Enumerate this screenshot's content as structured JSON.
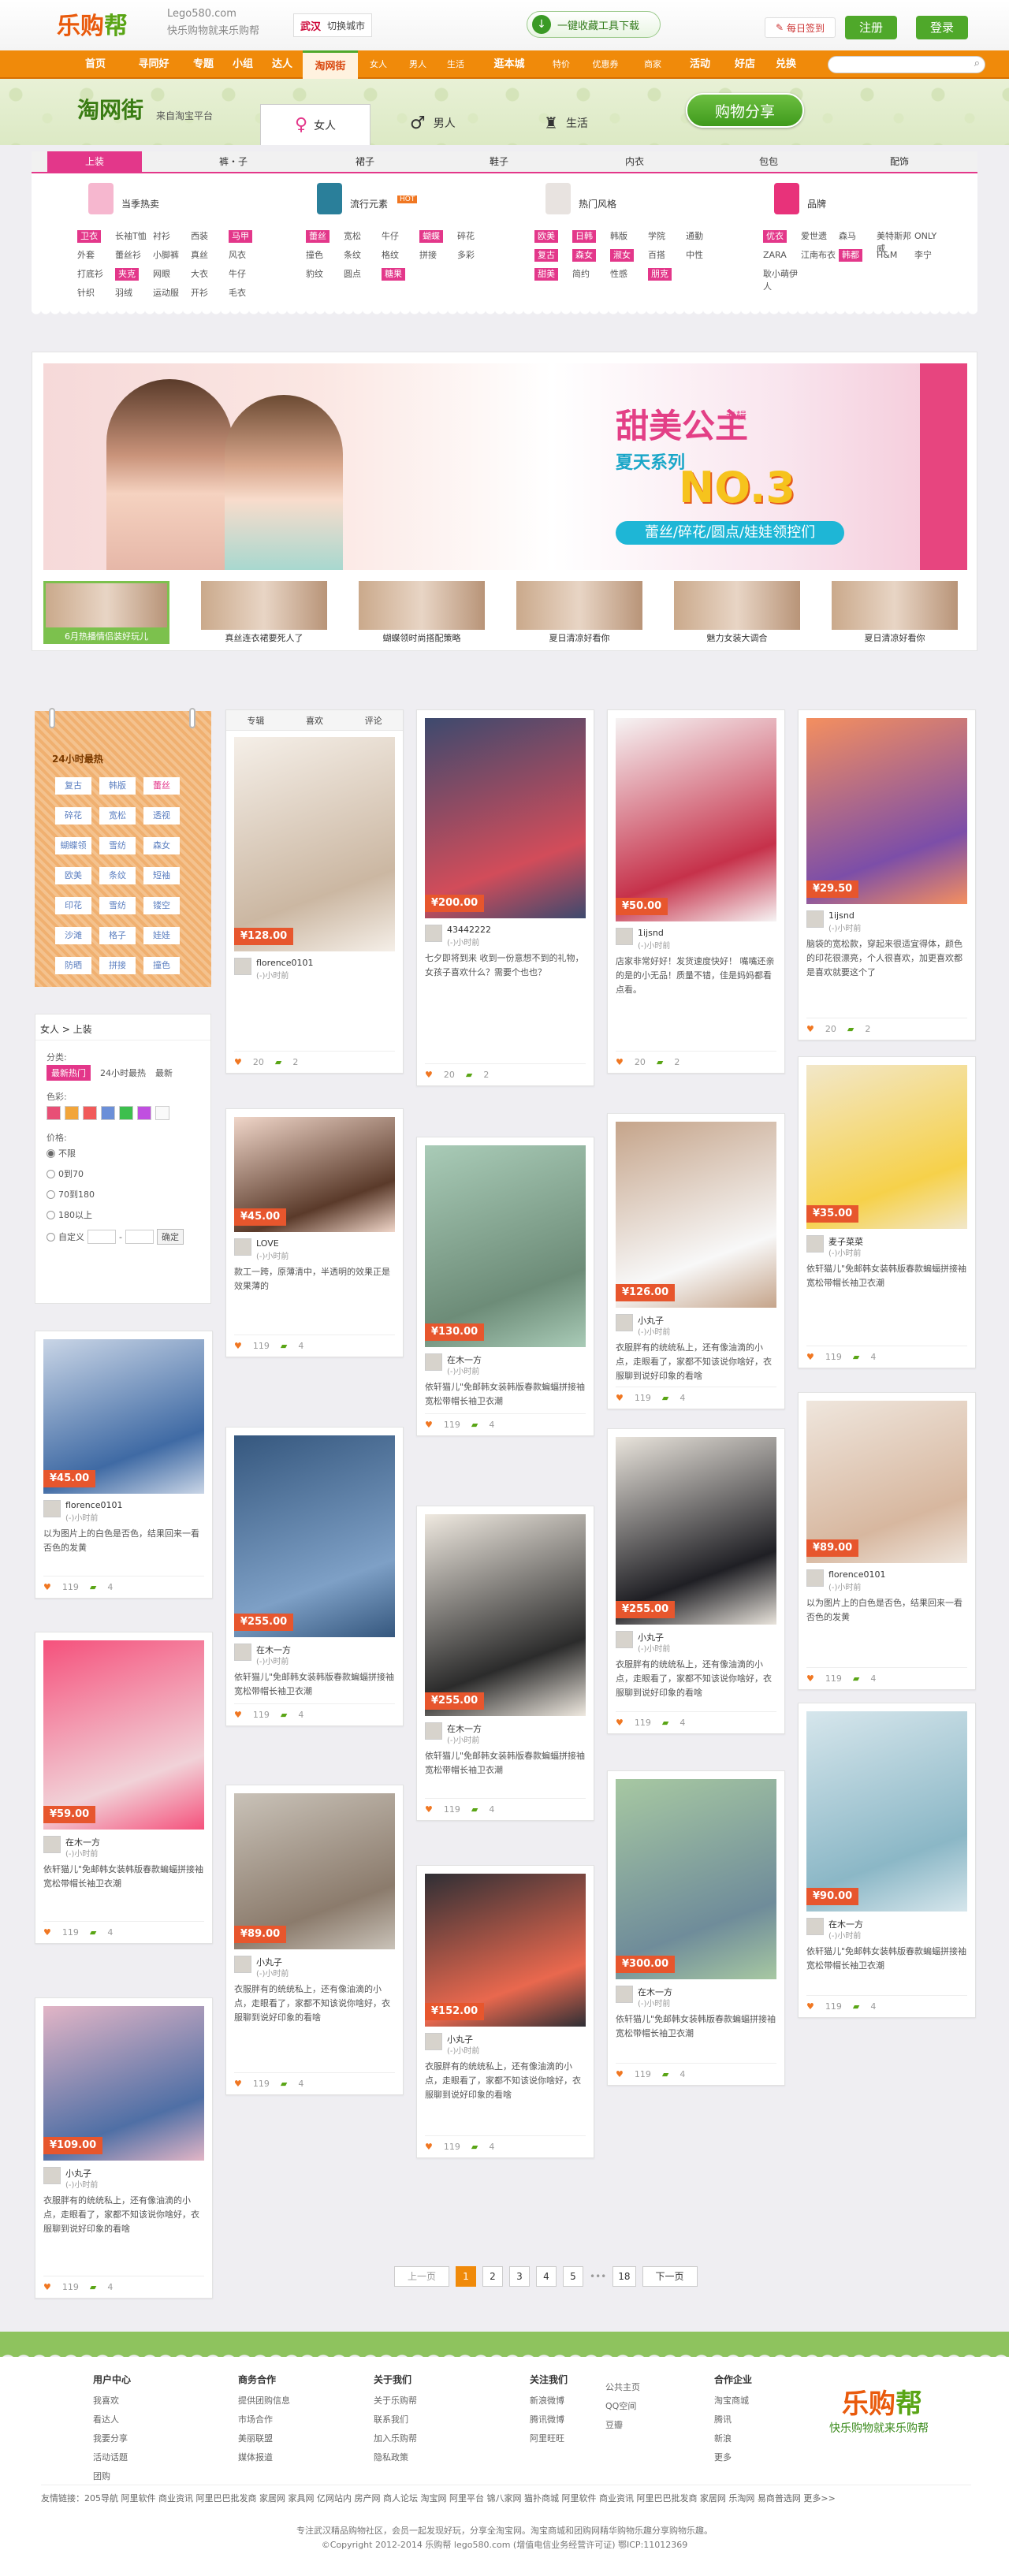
{
  "topbar": {
    "logo_main": "乐购",
    "logo_accent": "帮",
    "domain": "Lego580.com",
    "slogan": "快乐购物就来乐购帮",
    "city": "武汉",
    "switch_city": "切换城市",
    "collect_tool": "一键收藏工具下载",
    "daily_sign": "每日签到",
    "register": "注册",
    "login": "登录"
  },
  "nav": {
    "items": [
      "首页",
      "寻同好",
      "专题",
      "小组",
      "达人",
      "淘网街",
      "女人",
      "男人",
      "生活",
      "逛本城",
      "特价",
      "优惠券",
      "商家",
      "活动",
      "好店",
      "兑换"
    ],
    "active": "淘网街"
  },
  "header": {
    "title": "淘网街",
    "subtitle": "来自淘宝平台",
    "tab_women": "女人",
    "tab_men": "男人",
    "tab_life": "生活",
    "share": "购物分享"
  },
  "categories": {
    "tabs": [
      "上装",
      "裤・子",
      "裙子",
      "鞋子",
      "内衣",
      "包包",
      "配饰"
    ],
    "columns": [
      {
        "title": "当季热卖",
        "color": "#f6b7cf",
        "tags": [
          "卫衣",
          "长袖T恤",
          "衬衫",
          "西装",
          "马甲",
          "外套",
          "蕾丝衫",
          "小脚裤",
          "真丝",
          "风衣",
          "打底衫",
          "夹克",
          "网眼",
          "大衣",
          "牛仔",
          "针织",
          "羽绒",
          "运动服",
          "开衫",
          "毛衣"
        ],
        "hl": [
          "卫衣",
          "马甲",
          "夹克"
        ]
      },
      {
        "title": "流行元素",
        "badge": "HOT",
        "color": "#2a7f9a",
        "tags": [
          "蕾丝",
          "宽松",
          "牛仔",
          "蝴蝶结",
          "碎花",
          "撞色",
          "条纹",
          "格纹",
          "拼接",
          "多彩",
          "豹纹",
          "圆点",
          "糖果色"
        ],
        "hl": [
          "蕾丝",
          "蝴蝶结",
          "糖果色"
        ]
      },
      {
        "title": "热门风格",
        "color": "#e8e3e0",
        "tags": [
          "欧美",
          "日韩",
          "韩版",
          "学院",
          "通勤",
          "复古",
          "森女",
          "淑女",
          "百搭",
          "中性",
          "甜美",
          "简约",
          "性感",
          "朋克"
        ],
        "hl": [
          "欧美",
          "日韩",
          "淑女",
          "复古",
          "森女",
          "甜美",
          "朋克"
        ]
      },
      {
        "title": "品牌",
        "color": "#e8327a",
        "tags": [
          "优衣库",
          "爱世遗",
          "森马",
          "美特斯邦威",
          "ONLY",
          "ZARA",
          "江南布衣",
          "韩都衣舍",
          "H&M",
          "李宁",
          "耿小萌伊人"
        ],
        "hl": [
          "优衣库",
          "韩都衣舍"
        ]
      }
    ]
  },
  "banner": {
    "t1": "甜美公主",
    "t2": "专辑",
    "t3": "夏天系列",
    "t4": "NO.3",
    "t5": "蕾丝/碎花/圆点/娃娃领控们",
    "thumbs": [
      "6月热播情侣装好玩儿",
      "真丝连衣裙要死人了",
      "蝴蝶领时尚搭配策略",
      "夏日清凉好看你",
      "魅力女装大调合",
      "夏日清凉好看你"
    ]
  },
  "sidebar": {
    "hot_title": "24小时最热",
    "hot_tags": [
      "复古",
      "韩版",
      "蕾丝",
      "碎花",
      "宽松",
      "透视",
      "蝴蝶领",
      "雪纺",
      "森女",
      "欧美",
      "条纹",
      "短袖",
      "印花",
      "雪纺",
      "镂空",
      "沙滩",
      "格子",
      "娃娃",
      "防晒",
      "拼接",
      "撞色"
    ],
    "breadcrumb": "女人 > 上装",
    "sort_label": "分类:",
    "sort_options": [
      "最新热门",
      "24小时最热",
      "最新"
    ],
    "color_label": "色彩:",
    "colors": [
      "#e84f76",
      "#f2a53a",
      "#f15a5a",
      "#6b8fd8",
      "#3dbf4e",
      "#c04fe0",
      "#fafafa"
    ],
    "price_label": "价格:",
    "prices": [
      "不限",
      "0到70",
      "70到180",
      "180以上",
      "自定义"
    ],
    "confirm": "确定"
  },
  "cards": [
    {
      "col": 0,
      "price": "¥128.00",
      "user": "florence0101",
      "meta": "(-)小时前",
      "desc": "",
      "likes": "20",
      "comments": "2",
      "pic": "#f5efe8",
      "pic2": "#cbb7a2"
    },
    {
      "col": 0,
      "price": "¥45.00",
      "user": "LOVE",
      "meta": "(-)小时前",
      "desc": "款工一跨，原薄清中，半透明的效果正是效果薄的",
      "likes": "119",
      "comments": "4",
      "pic": "#f0d6c9",
      "pic2": "#5a3a2a"
    },
    {
      "col": 1,
      "price": "¥200.00",
      "user": "43442222",
      "meta": "(-)小时前",
      "desc": "七夕即将到来 收到一份意想不到的礼物，女孩子喜欢什么？需要个也也？",
      "likes": "20",
      "comments": "2",
      "pic": "#3d4a6e",
      "pic2": "#d24c5a"
    },
    {
      "col": 1,
      "price": "¥130.00",
      "user": "在木一方",
      "meta": "(-)小时前",
      "desc": "依轩猫儿\"免邮韩女装韩版春款蝙蝠拼接袖宽松带帽长袖卫衣潮",
      "likes": "119",
      "comments": "4",
      "pic": "#a9cbb7",
      "pic2": "#6d8c78"
    },
    {
      "col": 1,
      "price": "¥255.00",
      "user": "在木一方",
      "meta": "(-)小时前",
      "desc": "依轩猫儿\"免邮韩女装韩版春款蝙蝠拼接袖宽松带帽长袖卫衣潮",
      "likes": "119",
      "comments": "4",
      "pic": "#35577e",
      "pic2": "#7ea0c6"
    },
    {
      "col": 1,
      "price": "¥89.00",
      "user": "小丸子",
      "meta": "(-)小时前",
      "desc": "衣服胖有的统统私上，还有像油滴的小点，走眼看了，家都不知该说你啥好，衣服聊到说好印象的看啥",
      "likes": "119",
      "comments": "4",
      "pic": "#c9c2b8",
      "pic2": "#8b7b6c"
    },
    {
      "col": 2,
      "price": "¥50.00",
      "user": "1ijsnd",
      "meta": "(-)小时前",
      "desc": "店家非常好好！发货速度快好！ 嘴嘴还亲的是的小无品！质量不错，佳是妈妈都看点看。",
      "likes": "20",
      "comments": "2",
      "pic": "#f6f4f4",
      "pic2": "#c6314a"
    },
    {
      "col": 2,
      "price": "¥255.00",
      "user": "在木一方",
      "meta": "(-)小时前",
      "desc": "依轩猫儿\"免邮韩女装韩版春款蝙蝠拼接袖宽松带帽长袖卫衣潮",
      "likes": "119",
      "comments": "4",
      "pic": "#efe9e0",
      "pic2": "#2b2b2b"
    },
    {
      "col": 2,
      "price": "¥152.00",
      "user": "小丸子",
      "meta": "(-)小时前",
      "desc": "衣服胖有的统统私上，还有像油滴的小点，走眼看了，家都不知该说你啥好，衣服聊到说好印象的看啥",
      "likes": "119",
      "comments": "4",
      "pic": "#2f2f35",
      "pic2": "#e9684e"
    },
    {
      "col": 3,
      "price": "¥126.00",
      "user": "小丸子",
      "meta": "(-)小时前",
      "desc": "衣服胖有的统统私上，还有像油滴的小点，走眼看了，家都不知该说你啥好，衣服聊到说好印象的看啥",
      "likes": "119",
      "comments": "4",
      "pic": "#c5a48a",
      "pic2": "#f8f8f8"
    },
    {
      "col": 3,
      "price": "¥255.00",
      "user": "小丸子",
      "meta": "(-)小时前",
      "desc": "衣服胖有的统统私上，还有像油滴的小点，走眼看了，家都不知该说你啥好，衣服聊到说好印象的看啥",
      "likes": "119",
      "comments": "4",
      "pic": "#e9e4dc",
      "pic2": "#1f1f24"
    },
    {
      "col": 3,
      "price": "¥300.00",
      "user": "在木一方",
      "meta": "(-)小时前",
      "desc": "依轩猫儿\"免邮韩女装韩版春款蝙蝠拼接袖宽松带帽长袖卫衣潮",
      "likes": "119",
      "comments": "4",
      "pic": "#a7c8a2",
      "pic2": "#6f8c9a"
    },
    {
      "col": 4,
      "price": "¥29.50",
      "user": "1ijsnd",
      "meta": "(-)小时前",
      "desc": "脑袋的宽松款，穿起来很适宜得体，颜色的印花很漂亮，个人很喜欢，加更喜欢都是喜欢就要这个了",
      "likes": "20",
      "comments": "2",
      "pic": "#f48f5f",
      "pic2": "#7c4ea8"
    },
    {
      "col": 4,
      "price": "¥35.00",
      "user": "麦子菜菜",
      "meta": "(-)小时前",
      "desc": "依轩猫儿\"免邮韩女装韩版春款蝙蝠拼接袖宽松带帽长袖卫衣潮",
      "likes": "119",
      "comments": "4",
      "pic": "#f2e7c9",
      "pic2": "#f6d14a"
    },
    {
      "col": 4,
      "price": "¥89.00",
      "user": "florence0101",
      "meta": "(-)小时前",
      "desc": "以为图片上的白色是否色，结果回来一看否色的发黄",
      "likes": "119",
      "comments": "4",
      "pic": "#efe6dd",
      "pic2": "#d7b79f"
    },
    {
      "col": 4,
      "price": "¥90.00",
      "user": "在木一方",
      "meta": "(-)小时前",
      "desc": "依轩猫儿\"免邮韩女装韩版春款蝙蝠拼接袖宽松带帽长袖卫衣潮",
      "likes": "119",
      "comments": "4",
      "pic": "#d6e6ec",
      "pic2": "#8bb7c6"
    },
    {
      "col": 5,
      "price": "¥45.00",
      "user": "florence0101",
      "meta": "(-)小时前",
      "desc": "以为图片上的白色是否色，结果回来一看否色的发黄",
      "likes": "119",
      "comments": "4",
      "pic": "#c9d5e6",
      "pic2": "#3f6aa4"
    },
    {
      "col": 5,
      "price": "¥59.00",
      "user": "在木一方",
      "meta": "(-)小时前",
      "desc": "依轩猫儿\"免邮韩女装韩版春款蝙蝠拼接袖宽松带帽长袖卫衣潮",
      "likes": "119",
      "comments": "4",
      "pic": "#f5517c",
      "pic2": "#f1d2d8"
    },
    {
      "col": 5,
      "price": "¥109.00",
      "user": "小丸子",
      "meta": "(-)小时前",
      "desc": "衣服胖有的统统私上，还有像油滴的小点，走眼看了，家都不知该说你啥好，衣服聊到说好印象的看啥",
      "likes": "119",
      "comments": "4",
      "pic": "#e2b5c6",
      "pic2": "#4f6fa5"
    }
  ],
  "card_actions": [
    "专辑",
    "喜欢",
    "评论"
  ],
  "pager": {
    "prev": "上一页",
    "pages": [
      "1",
      "2",
      "3",
      "4",
      "5"
    ],
    "ellipsis": "•••",
    "last": "18",
    "next": "下一页"
  },
  "footer": {
    "cols": [
      {
        "head": "用户中心",
        "links": [
          "我喜欢",
          "看达人",
          "我要分享",
          "活动话题",
          "团购"
        ]
      },
      {
        "head": "商务合作",
        "links": [
          "提供团购信息",
          "市场合作",
          "美丽联盟",
          "媒体报道"
        ]
      },
      {
        "head": "关于我们",
        "links": [
          "关于乐购帮",
          "联系我们",
          "加入乐购帮",
          "隐私政策"
        ]
      },
      {
        "head": "关注我们",
        "links": [
          "新浪微博",
          "腾讯微博",
          "阿里旺旺"
        ]
      },
      {
        "head": "",
        "links": [
          "公共主页",
          "QQ空间",
          "豆瓣"
        ]
      },
      {
        "head": "合作企业",
        "links": [
          "淘宝商城",
          "腾讯",
          "新浪",
          "更多"
        ]
      }
    ],
    "logo_main": "乐购",
    "logo_accent": "帮",
    "slogan": "快乐购物就来乐购帮",
    "friend_links": "友情链接：205导航  阿里软件  商业资讯  阿里巴巴批发商  家居网  家具网  亿网站内  房产网  商人论坛  淘宝网  阿里平台  锦八家网  猫扑商城  阿里软件  商业资讯  阿里巴巴批发商  家居网  乐淘网  易商普选网  更多>>",
    "copy1": "专注武汉精品购物社区，会员一起发现好玩，分享全淘宝网。淘宝商城和团购网精华购物乐趣分享购物乐趣。",
    "copy2": "©Copyright 2012-2014 乐购帮 lego580.com (增值电信业务经营许可证) 鄂ICP:11012369"
  }
}
